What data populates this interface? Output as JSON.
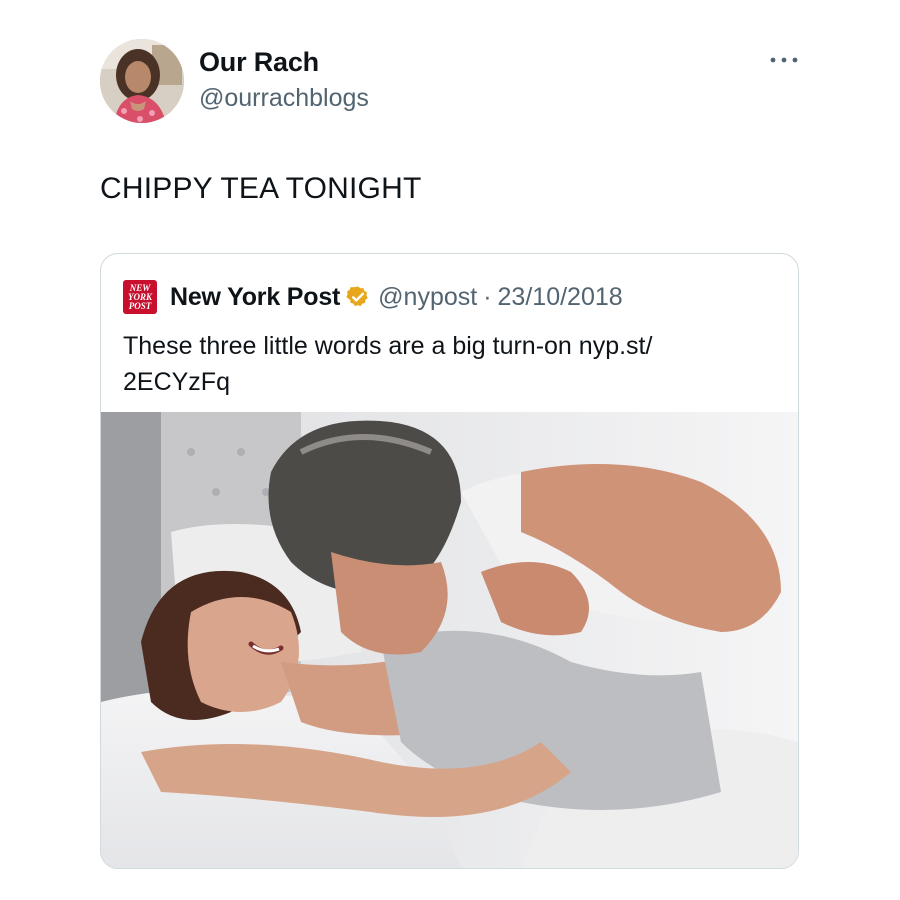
{
  "tweet": {
    "author": {
      "display_name": "Our Rach",
      "handle": "@ourrachblogs",
      "avatar_icon": "profile-photo"
    },
    "more_icon": "ellipsis-icon",
    "text": "CHIPPY TEA TONIGHT",
    "quoted_tweet": {
      "display_name": "New York Post",
      "logo_icon": "new-york-post-logo",
      "logo_text": [
        "NEW",
        "YORK",
        "POST"
      ],
      "verified_badge": "gold-verified-badge",
      "handle": "@nypost",
      "separator": "·",
      "date": "23/10/2018",
      "text_lines": [
        "These three little words are a big turn-on nyp.st/",
        "2ECYzFq"
      ],
      "media": "photo of a couple embracing in bed"
    }
  },
  "colors": {
    "text_primary": "#0f1419",
    "text_secondary": "#536471",
    "border": "#cfd9de",
    "nyp_red": "#c8102e",
    "verified_gold": "#e8a61d"
  }
}
